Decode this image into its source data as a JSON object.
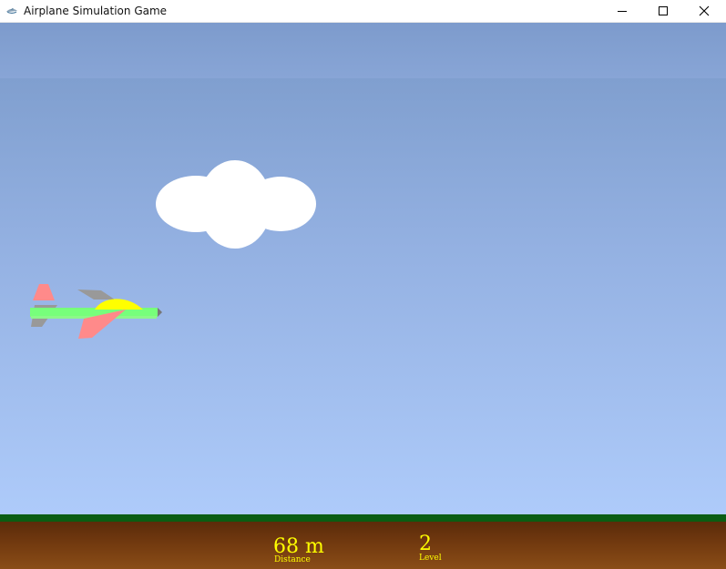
{
  "window": {
    "title": "Airplane Simulation Game",
    "controls": [
      "minimize",
      "maximize",
      "close"
    ]
  },
  "scene": {
    "sky_colors": [
      "#7f9ccd",
      "#94b1e2",
      "#aecbfa"
    ],
    "cloud_color": "#ffffff",
    "ground_colors": [
      "#0b5d13",
      "#5b2b0a",
      "#8a4d17"
    ],
    "airplane_colors": {
      "fuselage": "#77ff7b",
      "canopy": "#ffff00",
      "tail": "#ff8a8a",
      "wings": "#999999",
      "nose": "#777777"
    }
  },
  "hud": {
    "distance_value": "68 m",
    "distance_label": "Distance",
    "level_value": "2",
    "level_label": "Level",
    "text_color": "#ffff00"
  }
}
